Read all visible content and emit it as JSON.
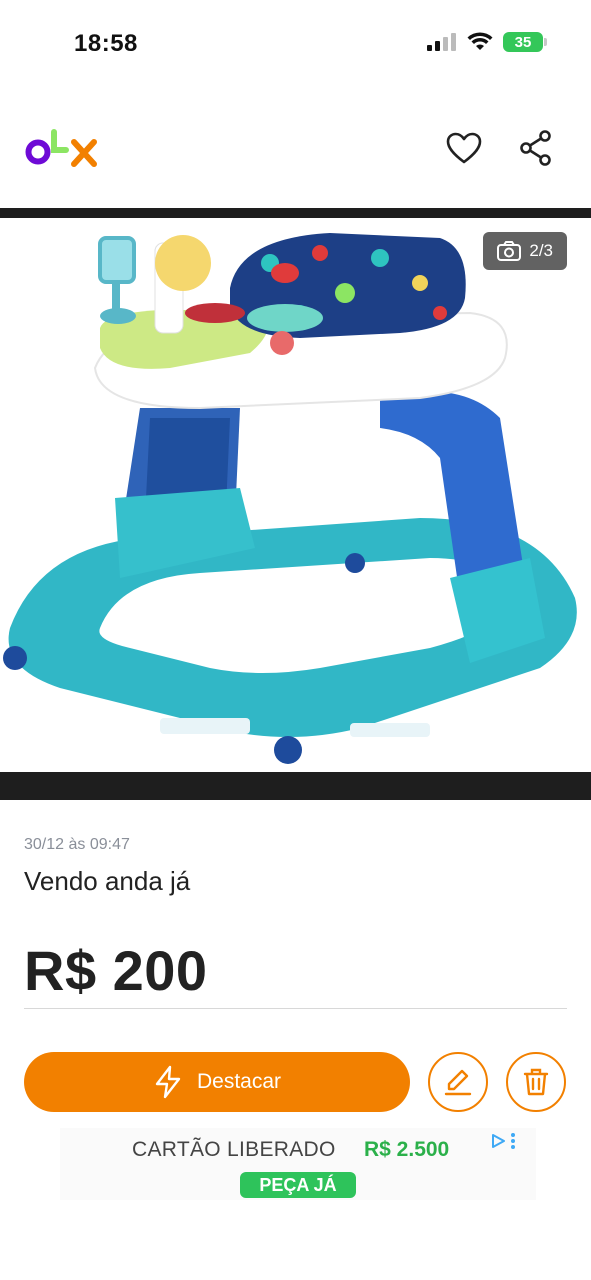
{
  "status_bar": {
    "time": "18:58",
    "battery": "35",
    "icons": [
      "signal-icon",
      "wifi-icon",
      "battery-icon"
    ]
  },
  "header": {
    "logo_letters": [
      "O",
      "L",
      "X"
    ],
    "logo_colors": [
      "#6e0ad6",
      "#8ce563",
      "#f28000"
    ],
    "actions": [
      "heart-icon",
      "share-icon"
    ]
  },
  "gallery": {
    "counter": "2/3",
    "image_subject": "baby walker"
  },
  "listing": {
    "date": "30/12 às 09:47",
    "title": "Vendo anda já",
    "price": "R$ 200"
  },
  "actions": {
    "highlight_label": "Destacar",
    "edit_icon": "pencil-icon",
    "delete_icon": "trash-icon",
    "accent": "#f28000"
  },
  "ad": {
    "text": "CARTÃO LIBERADO",
    "price": "R$ 2.500",
    "cta": "PEÇA JÁ",
    "accent": "#2ec35b"
  }
}
